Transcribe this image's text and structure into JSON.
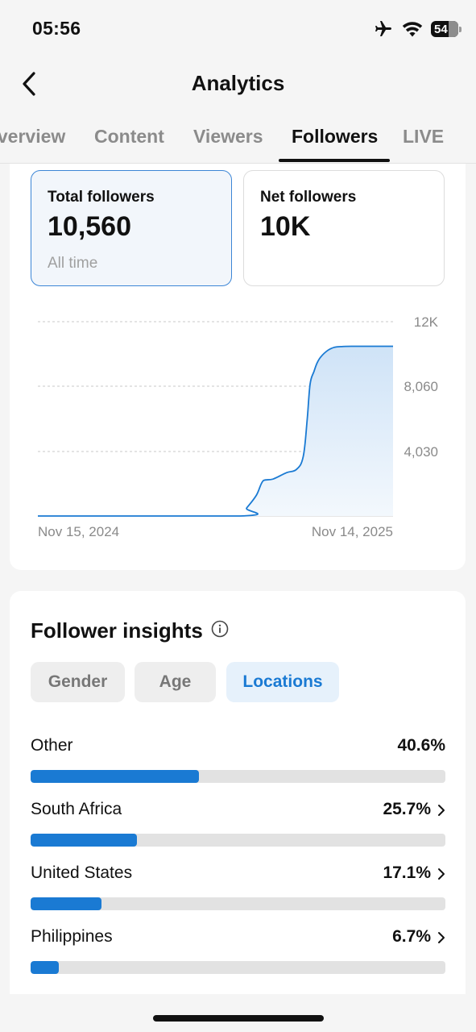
{
  "status": {
    "time": "05:56",
    "battery": "54"
  },
  "nav": {
    "title": "Analytics"
  },
  "tabs": [
    {
      "label": "Overview"
    },
    {
      "label": "Content"
    },
    {
      "label": "Viewers"
    },
    {
      "label": "Followers"
    },
    {
      "label": "LIVE"
    }
  ],
  "active_tab": "Followers",
  "stats": {
    "total": {
      "label": "Total followers",
      "value": "10,560",
      "sub": "All time"
    },
    "net": {
      "label": "Net followers",
      "value": "10K"
    }
  },
  "chart_data": {
    "type": "area",
    "y_ticks": [
      "12K",
      "8,060",
      "4,030"
    ],
    "x_labels": [
      "Nov 15, 2024",
      "Nov 14, 2025"
    ],
    "ylim": [
      0,
      12090
    ],
    "grid": true,
    "series": [
      {
        "x": [
          "2024-11-15",
          "2025-06-10",
          "2025-06-17",
          "2025-06-27",
          "2025-07-04",
          "2025-07-14",
          "2025-07-28",
          "2025-08-07",
          "2025-08-14",
          "2025-08-18",
          "2025-08-21",
          "2025-08-25",
          "2025-08-28",
          "2025-09-01",
          "2025-09-08",
          "2025-09-15",
          "2025-09-22",
          "2025-10-02",
          "2025-11-14"
        ],
        "values": [
          0,
          0,
          500,
          1300,
          2200,
          2300,
          2700,
          2900,
          3700,
          6000,
          8200,
          9000,
          9500,
          9900,
          10300,
          10500,
          10540,
          10560,
          10560
        ]
      }
    ],
    "colors": {
      "line": "#1a7ad3",
      "fill_top": "#cfe3f7",
      "fill_bottom": "#f3f8fd"
    }
  },
  "insights": {
    "title": "Follower insights",
    "chips": {
      "gender": "Gender",
      "age": "Age",
      "locations": "Locations"
    },
    "locations": [
      {
        "name": "Other",
        "percent": "40.6%",
        "value": 40.6,
        "chevron": false
      },
      {
        "name": "South Africa",
        "percent": "25.7%",
        "value": 25.7,
        "chevron": true
      },
      {
        "name": "United States",
        "percent": "17.1%",
        "value": 17.1,
        "chevron": true
      },
      {
        "name": "Philippines",
        "percent": "6.7%",
        "value": 6.7,
        "chevron": true
      }
    ]
  },
  "colors": {
    "accent": "#1a7ad3",
    "selected_bg": "#f2f6fb",
    "chip_active_bg": "#e6f1fb"
  }
}
